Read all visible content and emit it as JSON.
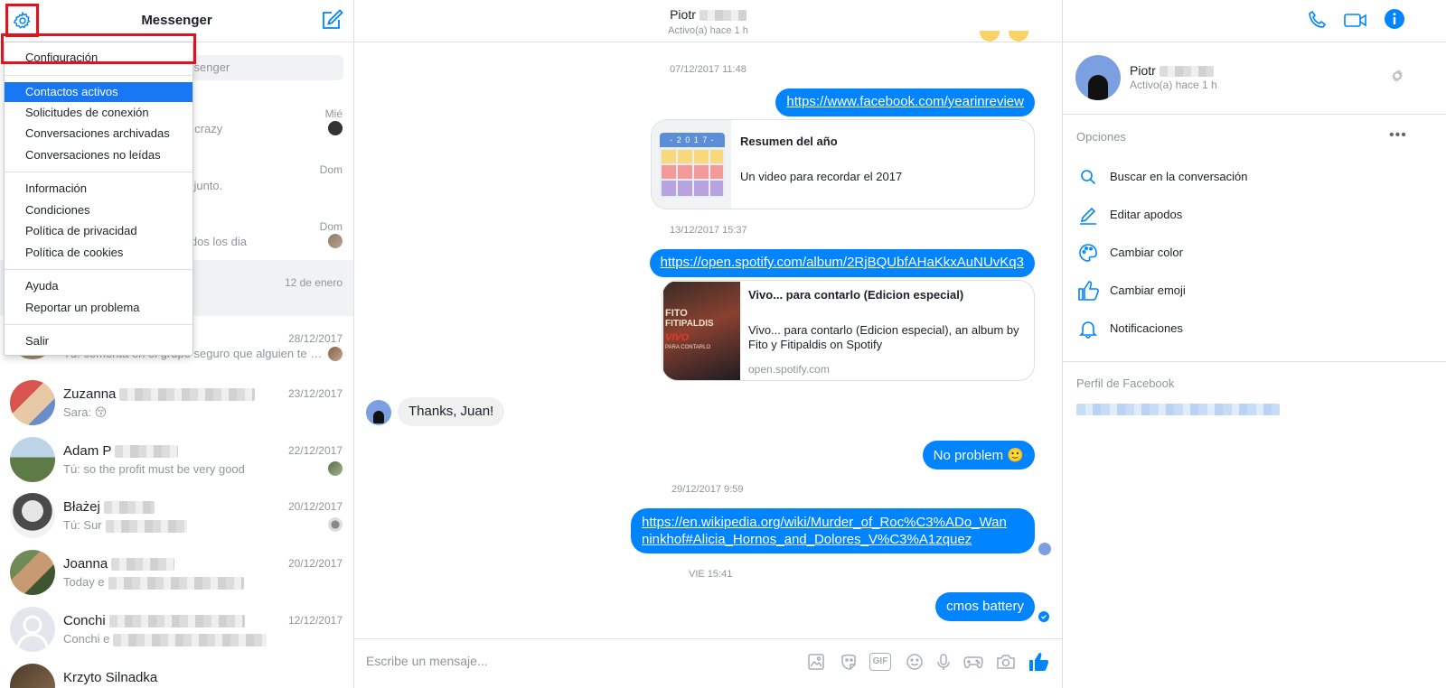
{
  "left_panel": {
    "title": "Messenger",
    "search_placeholder": "ssenger",
    "conversations": [
      {
        "name": "",
        "snippet": "re crazy",
        "date": "Mié"
      },
      {
        "name": "",
        "snippet": "adjunto.",
        "date": "Dom"
      },
      {
        "name": "",
        "snippet": "todos los dia",
        "date": "Dom"
      },
      {
        "name": "",
        "snippet": "",
        "date": "12 de enero"
      },
      {
        "name": "",
        "snippet": "Tú: comenta en el grupo seguro que alguien te pu...",
        "date": "28/12/2017"
      },
      {
        "name": "Zuzanna",
        "snippet": "Sara: 😚",
        "date": "23/12/2017"
      },
      {
        "name": "Adam P",
        "snippet": "Tú: so the profit must be very good",
        "date": "22/12/2017"
      },
      {
        "name": "Błażej",
        "snippet": "Tú: Sur",
        "date": "20/12/2017"
      },
      {
        "name": "Joanna",
        "snippet": "Today e",
        "date": "20/12/2017"
      },
      {
        "name": "Conchi",
        "snippet": "Conchi e",
        "date": "12/12/2017"
      },
      {
        "name": "Krzyto Silnadka",
        "snippet": "",
        "date": ""
      }
    ]
  },
  "settings_menu": {
    "items": [
      "Configuración",
      "Contactos activos",
      "Solicitudes de conexión",
      "Conversaciones archivadas",
      "Conversaciones no leídas",
      "Información",
      "Condiciones",
      "Política de privacidad",
      "Política de cookies",
      "Ayuda",
      "Reportar un problema",
      "Salir"
    ],
    "highlighted": "Contactos activos"
  },
  "chat": {
    "contact_name": "Piotr",
    "status": "Activo(a) hace 1 h",
    "messages": {
      "ts1": "07/12/2017 11:48",
      "link1": "https://www.facebook.com/yearinreview",
      "card1_title": "Resumen del año",
      "card1_desc": "Un video para recordar el 2017",
      "card1_badge": "- 2 0 1 7 -",
      "ts2": "13/12/2017 15:37",
      "link2": "https://open.spotify.com/album/2RjBQUbfAHaKkxAuNUvKq3",
      "card2_title": "Vivo... para contarlo (Edicion especial)",
      "card2_desc": "Vivo... para contarlo (Edicion especial), an album by Fito y Fitipaldis on Spotify",
      "card2_domain": "open.spotify.com",
      "album_text_1": "FITO",
      "album_text_2": "FITIPALDIS",
      "album_text_3": "VIVO",
      "album_text_4": "PARA CONTARLO",
      "incoming1": "Thanks, Juan!",
      "outgoing1": "No problem 🙂",
      "ts3": "29/12/2017 9:59",
      "link3_line1": "https://en.wikipedia.org/wiki/Murder_of_Roc%C3%ADo_Wan",
      "link3_line2": "ninkhof#Alicia_Hornos_and_Dolores_V%C3%A1zquez",
      "ts4": "VIE 15:41",
      "outgoing2": "cmos battery"
    },
    "composer_placeholder": "Escribe un mensaje...",
    "composer_gif": "GIF"
  },
  "right_panel": {
    "name": "Piotr",
    "status": "Activo(a) hace 1 h",
    "options_label": "Opciones",
    "options": [
      {
        "icon": "search-icon",
        "label": "Buscar en la conversación"
      },
      {
        "icon": "pencil-icon",
        "label": "Editar apodos"
      },
      {
        "icon": "palette-icon",
        "label": "Cambiar color"
      },
      {
        "icon": "thumbs-up-icon",
        "label": "Cambiar emoji"
      },
      {
        "icon": "bell-icon",
        "label": "Notificaciones"
      }
    ],
    "facebook_profile_label": "Perfil de Facebook"
  },
  "colors": {
    "accent": "#0084ff",
    "menu_highlight": "#1877f2",
    "annotation_red": "#e0141e"
  }
}
